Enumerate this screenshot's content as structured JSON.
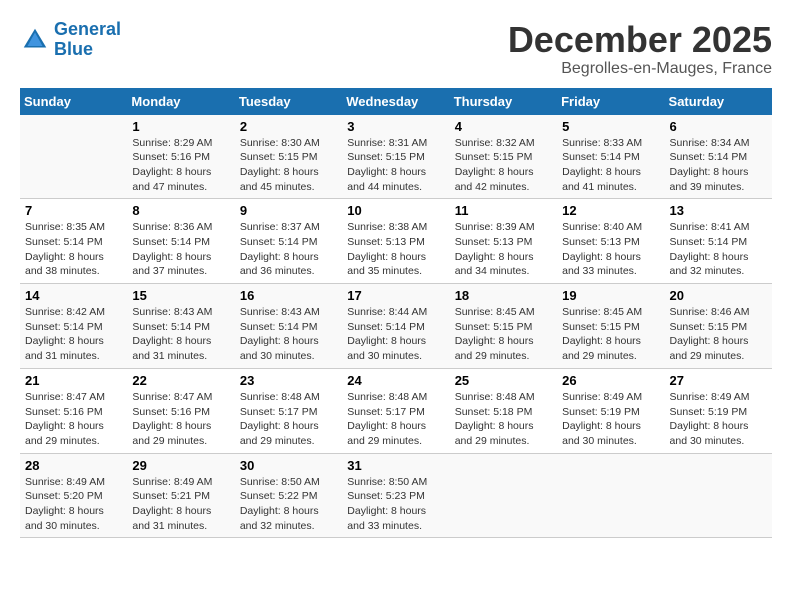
{
  "header": {
    "logo_line1": "General",
    "logo_line2": "Blue",
    "month_title": "December 2025",
    "location": "Begrolles-en-Mauges, France"
  },
  "weekdays": [
    "Sunday",
    "Monday",
    "Tuesday",
    "Wednesday",
    "Thursday",
    "Friday",
    "Saturday"
  ],
  "weeks": [
    [
      {
        "day": "",
        "sunrise": "",
        "sunset": "",
        "daylight": ""
      },
      {
        "day": "1",
        "sunrise": "Sunrise: 8:29 AM",
        "sunset": "Sunset: 5:16 PM",
        "daylight": "Daylight: 8 hours and 47 minutes."
      },
      {
        "day": "2",
        "sunrise": "Sunrise: 8:30 AM",
        "sunset": "Sunset: 5:15 PM",
        "daylight": "Daylight: 8 hours and 45 minutes."
      },
      {
        "day": "3",
        "sunrise": "Sunrise: 8:31 AM",
        "sunset": "Sunset: 5:15 PM",
        "daylight": "Daylight: 8 hours and 44 minutes."
      },
      {
        "day": "4",
        "sunrise": "Sunrise: 8:32 AM",
        "sunset": "Sunset: 5:15 PM",
        "daylight": "Daylight: 8 hours and 42 minutes."
      },
      {
        "day": "5",
        "sunrise": "Sunrise: 8:33 AM",
        "sunset": "Sunset: 5:14 PM",
        "daylight": "Daylight: 8 hours and 41 minutes."
      },
      {
        "day": "6",
        "sunrise": "Sunrise: 8:34 AM",
        "sunset": "Sunset: 5:14 PM",
        "daylight": "Daylight: 8 hours and 39 minutes."
      }
    ],
    [
      {
        "day": "7",
        "sunrise": "Sunrise: 8:35 AM",
        "sunset": "Sunset: 5:14 PM",
        "daylight": "Daylight: 8 hours and 38 minutes."
      },
      {
        "day": "8",
        "sunrise": "Sunrise: 8:36 AM",
        "sunset": "Sunset: 5:14 PM",
        "daylight": "Daylight: 8 hours and 37 minutes."
      },
      {
        "day": "9",
        "sunrise": "Sunrise: 8:37 AM",
        "sunset": "Sunset: 5:14 PM",
        "daylight": "Daylight: 8 hours and 36 minutes."
      },
      {
        "day": "10",
        "sunrise": "Sunrise: 8:38 AM",
        "sunset": "Sunset: 5:13 PM",
        "daylight": "Daylight: 8 hours and 35 minutes."
      },
      {
        "day": "11",
        "sunrise": "Sunrise: 8:39 AM",
        "sunset": "Sunset: 5:13 PM",
        "daylight": "Daylight: 8 hours and 34 minutes."
      },
      {
        "day": "12",
        "sunrise": "Sunrise: 8:40 AM",
        "sunset": "Sunset: 5:13 PM",
        "daylight": "Daylight: 8 hours and 33 minutes."
      },
      {
        "day": "13",
        "sunrise": "Sunrise: 8:41 AM",
        "sunset": "Sunset: 5:14 PM",
        "daylight": "Daylight: 8 hours and 32 minutes."
      }
    ],
    [
      {
        "day": "14",
        "sunrise": "Sunrise: 8:42 AM",
        "sunset": "Sunset: 5:14 PM",
        "daylight": "Daylight: 8 hours and 31 minutes."
      },
      {
        "day": "15",
        "sunrise": "Sunrise: 8:43 AM",
        "sunset": "Sunset: 5:14 PM",
        "daylight": "Daylight: 8 hours and 31 minutes."
      },
      {
        "day": "16",
        "sunrise": "Sunrise: 8:43 AM",
        "sunset": "Sunset: 5:14 PM",
        "daylight": "Daylight: 8 hours and 30 minutes."
      },
      {
        "day": "17",
        "sunrise": "Sunrise: 8:44 AM",
        "sunset": "Sunset: 5:14 PM",
        "daylight": "Daylight: 8 hours and 30 minutes."
      },
      {
        "day": "18",
        "sunrise": "Sunrise: 8:45 AM",
        "sunset": "Sunset: 5:15 PM",
        "daylight": "Daylight: 8 hours and 29 minutes."
      },
      {
        "day": "19",
        "sunrise": "Sunrise: 8:45 AM",
        "sunset": "Sunset: 5:15 PM",
        "daylight": "Daylight: 8 hours and 29 minutes."
      },
      {
        "day": "20",
        "sunrise": "Sunrise: 8:46 AM",
        "sunset": "Sunset: 5:15 PM",
        "daylight": "Daylight: 8 hours and 29 minutes."
      }
    ],
    [
      {
        "day": "21",
        "sunrise": "Sunrise: 8:47 AM",
        "sunset": "Sunset: 5:16 PM",
        "daylight": "Daylight: 8 hours and 29 minutes."
      },
      {
        "day": "22",
        "sunrise": "Sunrise: 8:47 AM",
        "sunset": "Sunset: 5:16 PM",
        "daylight": "Daylight: 8 hours and 29 minutes."
      },
      {
        "day": "23",
        "sunrise": "Sunrise: 8:48 AM",
        "sunset": "Sunset: 5:17 PM",
        "daylight": "Daylight: 8 hours and 29 minutes."
      },
      {
        "day": "24",
        "sunrise": "Sunrise: 8:48 AM",
        "sunset": "Sunset: 5:17 PM",
        "daylight": "Daylight: 8 hours and 29 minutes."
      },
      {
        "day": "25",
        "sunrise": "Sunrise: 8:48 AM",
        "sunset": "Sunset: 5:18 PM",
        "daylight": "Daylight: 8 hours and 29 minutes."
      },
      {
        "day": "26",
        "sunrise": "Sunrise: 8:49 AM",
        "sunset": "Sunset: 5:19 PM",
        "daylight": "Daylight: 8 hours and 30 minutes."
      },
      {
        "day": "27",
        "sunrise": "Sunrise: 8:49 AM",
        "sunset": "Sunset: 5:19 PM",
        "daylight": "Daylight: 8 hours and 30 minutes."
      }
    ],
    [
      {
        "day": "28",
        "sunrise": "Sunrise: 8:49 AM",
        "sunset": "Sunset: 5:20 PM",
        "daylight": "Daylight: 8 hours and 30 minutes."
      },
      {
        "day": "29",
        "sunrise": "Sunrise: 8:49 AM",
        "sunset": "Sunset: 5:21 PM",
        "daylight": "Daylight: 8 hours and 31 minutes."
      },
      {
        "day": "30",
        "sunrise": "Sunrise: 8:50 AM",
        "sunset": "Sunset: 5:22 PM",
        "daylight": "Daylight: 8 hours and 32 minutes."
      },
      {
        "day": "31",
        "sunrise": "Sunrise: 8:50 AM",
        "sunset": "Sunset: 5:23 PM",
        "daylight": "Daylight: 8 hours and 33 minutes."
      },
      {
        "day": "",
        "sunrise": "",
        "sunset": "",
        "daylight": ""
      },
      {
        "day": "",
        "sunrise": "",
        "sunset": "",
        "daylight": ""
      },
      {
        "day": "",
        "sunrise": "",
        "sunset": "",
        "daylight": ""
      }
    ]
  ]
}
